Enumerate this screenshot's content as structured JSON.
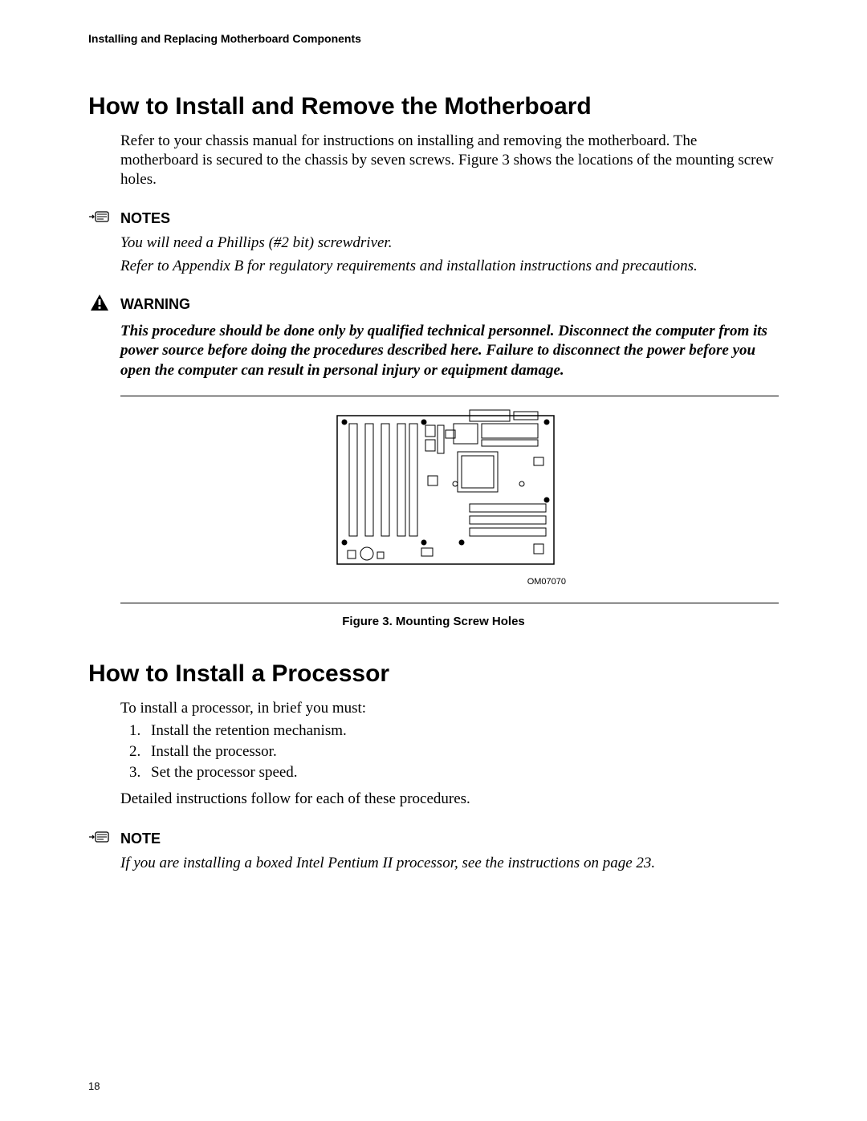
{
  "header": {
    "running_head": "Installing and Replacing Motherboard Components"
  },
  "section1": {
    "title": "How to Install and Remove the Motherboard",
    "para": "Refer to your chassis manual for instructions on installing and removing the motherboard. The motherboard is secured to the chassis by seven screws.  Figure 3 shows the locations of the mounting screw holes."
  },
  "notes1": {
    "heading": "NOTES",
    "line1": "You will need a Phillips (#2 bit) screwdriver.",
    "line2": "Refer to Appendix B for regulatory requirements and installation instructions and precautions."
  },
  "warning": {
    "heading": "WARNING",
    "body": "This procedure should be done only by qualified technical personnel.  Disconnect the computer from its power source before doing the procedures described here.  Failure to disconnect the power before you open the computer can result in personal injury or equipment damage."
  },
  "figure": {
    "ref": "OM07070",
    "caption": "Figure 3.  Mounting Screw Holes"
  },
  "section2": {
    "title": "How to Install a Processor",
    "intro": "To install a processor, in brief you must:",
    "steps": {
      "s1": "Install the retention mechanism.",
      "s2": "Install the processor.",
      "s3": "Set the processor speed."
    },
    "outro": "Detailed instructions follow for each of these procedures."
  },
  "note2": {
    "heading": "NOTE",
    "body": "If you are installing a boxed Intel Pentium II processor, see the instructions on page 23."
  },
  "page_number": "18"
}
